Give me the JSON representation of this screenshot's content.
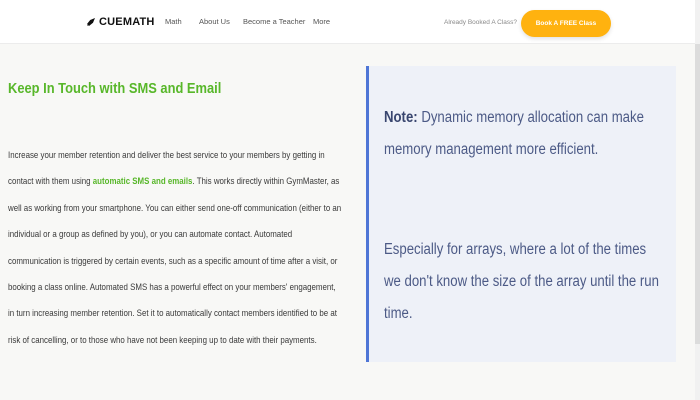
{
  "navbar": {
    "brand": "CUEMATH",
    "links": [
      "Math",
      "About Us",
      "Become a Teacher",
      "More"
    ],
    "booked_text": "Already Booked A Class?",
    "cta_label": "Book A FREE Class"
  },
  "article": {
    "heading": "Keep In Touch with SMS and Email",
    "body_part1": "Increase your member retention and deliver the best service to your members by getting in contact with them using ",
    "body_highlight": "automatic SMS and emails",
    "body_part2": ". This works directly within GymMaster, as well as working from your smartphone. You can either send one-off communication (either to an individual or a group as defined by you), or you can automate contact. Automated communication is triggered by certain events, such as a specific amount of time after a visit, or booking a class online. Automated SMS has a powerful effect on your members' engagement, in turn increasing member retention. Set it to automatically contact members identified to be at risk of cancelling, or to those who have not been keeping up to date with their payments."
  },
  "note": {
    "label": "Note:",
    "paragraph1": " Dynamic memory allocation can make memory management more efficient.",
    "paragraph2": "Especially for arrays, where a lot of the times we don't know the size of the array until the run time."
  },
  "colors": {
    "brand_green": "#58b72a",
    "cta_orange": "#ffb20f",
    "note_accent": "#4f76d6",
    "note_background": "#eef1f8"
  },
  "icons": {
    "brand": "rocket-icon"
  }
}
